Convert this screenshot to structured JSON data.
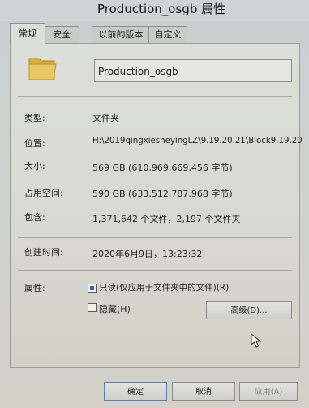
{
  "window": {
    "title": "Production_osgb 属性"
  },
  "tabs": [
    {
      "label": "常规"
    },
    {
      "label": "安全"
    },
    {
      "label": "以前的版本"
    },
    {
      "label": "自定义"
    }
  ],
  "general": {
    "folder_name": "Production_osgb",
    "type_label": "类型:",
    "type_value": "文件夹",
    "location_label": "位置:",
    "location_value": "H:\\2019qingxiesheyingLZ\\9.19.20.21\\Block9.19.20",
    "size_label": "大小:",
    "size_value": "569 GB (610,969,669,456 字节)",
    "size_on_disk_label": "占用空间:",
    "size_on_disk_value": "590 GB (633,512,787,968 字节)",
    "contains_label": "包含:",
    "contains_value": "1,371,642 个文件，2,197 个文件夹",
    "created_label": "创建时间:",
    "created_value": "2020年6月9日，13:23:32",
    "attributes_label": "属性:",
    "readonly_label": "只读(仅应用于文件夹中的文件)(R)",
    "readonly_state": "partial",
    "hidden_label": "隐藏(H)",
    "hidden_state": "unchecked",
    "advanced_button": "高级(D)..."
  },
  "footer": {
    "ok": "确定",
    "cancel": "取消",
    "apply": "应用(A)"
  },
  "colors": {
    "checkbox_fill": "#2e63c7",
    "panel": "#dcdedb"
  }
}
